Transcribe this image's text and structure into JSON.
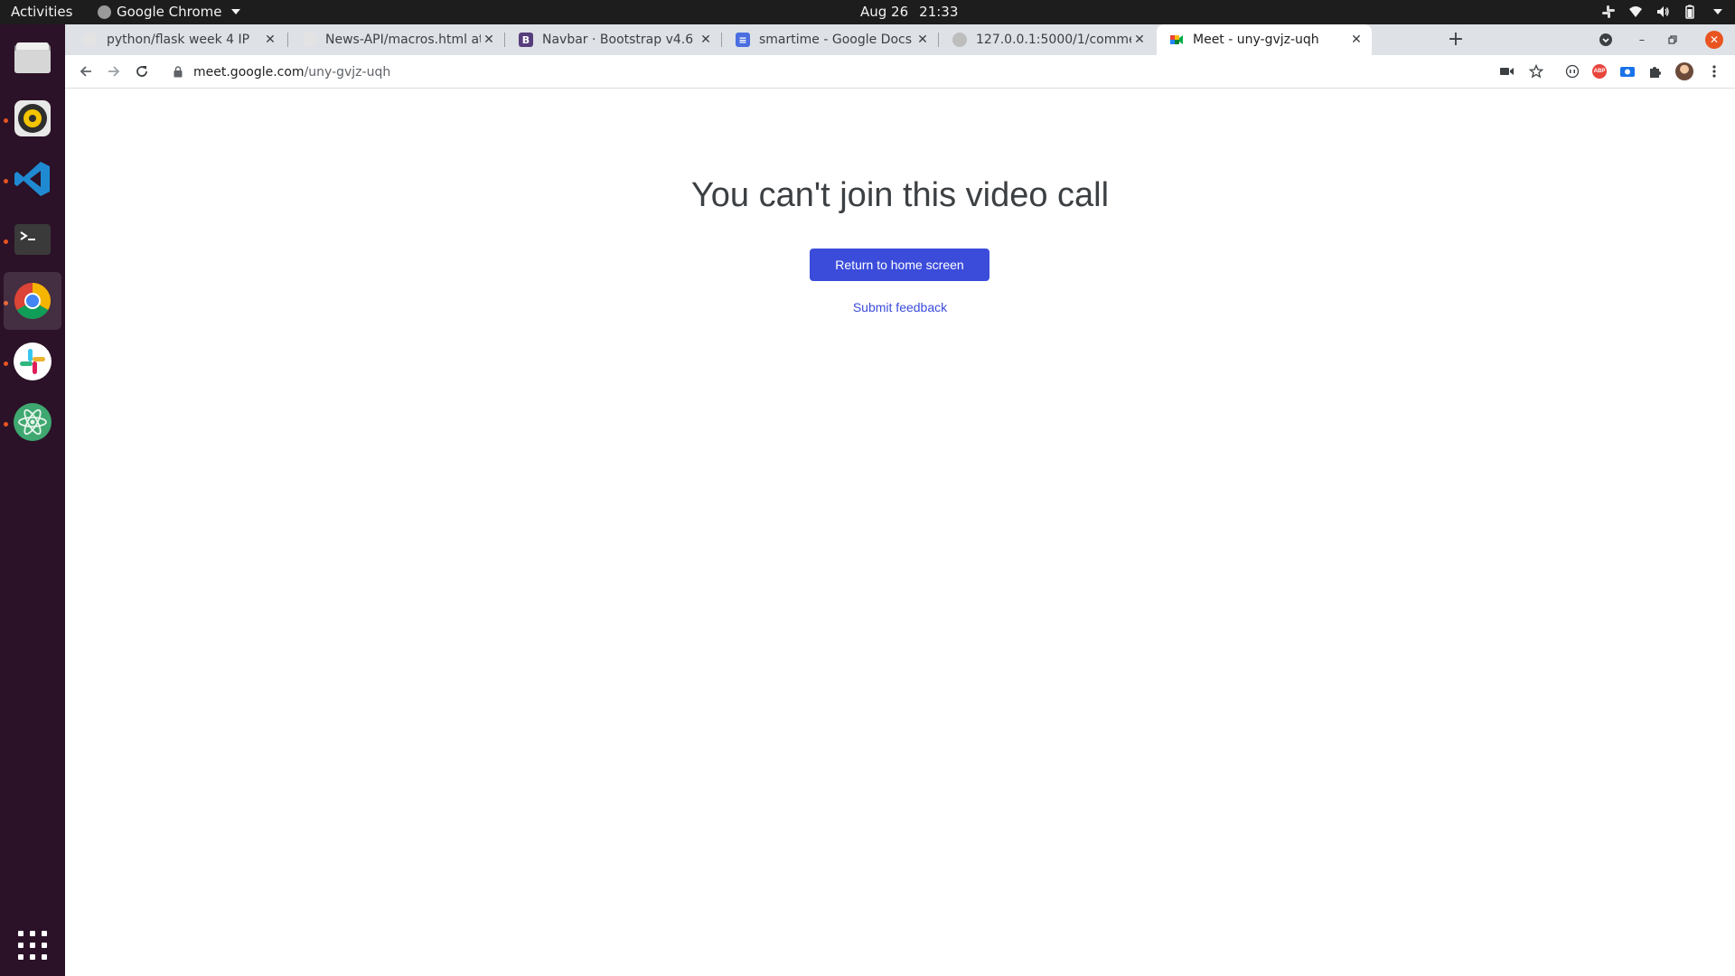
{
  "system_bar": {
    "activities_label": "Activities",
    "app_name": "Google Chrome",
    "date": "Aug 26",
    "time": "21:33"
  },
  "dock": {
    "apps": [
      "files",
      "rhythmbox",
      "vscode",
      "terminal",
      "chrome",
      "slack",
      "atom"
    ],
    "active_app": "chrome"
  },
  "browser": {
    "tabs": [
      {
        "title": "python/flask week 4 IP",
        "favicon": "github-icon",
        "active": false
      },
      {
        "title": "News-API/macros.html at",
        "favicon": "github-icon",
        "active": false
      },
      {
        "title": "Navbar · Bootstrap v4.6",
        "favicon": "bootstrap-icon",
        "active": false
      },
      {
        "title": "smartime - Google Docs",
        "favicon": "docs-icon",
        "active": false
      },
      {
        "title": "127.0.0.1:5000/1/commen",
        "favicon": "globe-icon",
        "active": false
      },
      {
        "title": "Meet - uny-gvjz-uqh",
        "favicon": "meet-icon",
        "active": true
      }
    ],
    "url_host": "meet.google.com",
    "url_path": "/uny-gvjz-uqh"
  },
  "page": {
    "title": "You can't join this video call",
    "primary_button": "Return to home screen",
    "feedback_link": "Submit feedback"
  },
  "colors": {
    "accent": "#3b4cdb",
    "dock_bg": "#2b1228",
    "topbar_bg": "#1d1d1d",
    "ubuntu_orange": "#e95420"
  }
}
